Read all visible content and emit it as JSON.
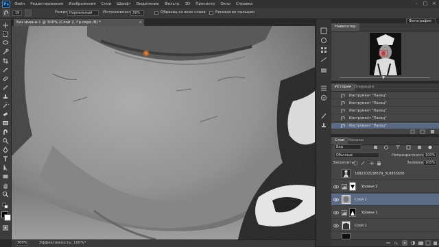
{
  "app": {
    "logo": "Ps"
  },
  "menu": [
    "Файл",
    "Редактирование",
    "Изображение",
    "Слои",
    "Шрифт",
    "Выделение",
    "Фильтр",
    "3D",
    "Просмотр",
    "Окно",
    "Справка"
  ],
  "window_controls": {
    "minimize": "–",
    "maximize": "□",
    "close": "×"
  },
  "options_bar": {
    "brush_size": "19",
    "mode_label": "Режим:",
    "mode_value": "Нормальный",
    "intensity_label": "Интенсивность:",
    "intensity_value": "39%",
    "sample_all_label": "Образец со всех слоев",
    "finger_paint_label": "Рисование пальцем",
    "workspace": "Фотография"
  },
  "document_tab": {
    "title": "Без имени-1 @ 300% (Слой 2, Гр.серо./8) *",
    "close": "×"
  },
  "status_bar": {
    "zoom": "300%",
    "efficiency": "Эффективность: 100%*"
  },
  "navigator": {
    "tab": "Навигатор"
  },
  "history": {
    "tabs": [
      "История",
      "Операции"
    ],
    "items": [
      "Инструмент \"Палец\"",
      "Инструмент \"Палец\"",
      "Инструмент \"Палец\"",
      "Инструмент \"Палец\"",
      "Инструмент \"Палец\""
    ]
  },
  "layers": {
    "tabs": [
      "Слои",
      "Каналы"
    ],
    "filter_kind": "Вид",
    "blend_mode": "Обычные",
    "opacity_label": "Непрозрачность:",
    "opacity_value": "100%",
    "lock_label": "Закрепить:",
    "fill_label": "Заливка:",
    "fill_value": "100%",
    "items": [
      {
        "name": "1682202198579_316855656"
      },
      {
        "name": "Уровни 2"
      },
      {
        "name": "Слой 2"
      },
      {
        "name": "Уровни 1"
      },
      {
        "name": "Слой 1"
      }
    ]
  },
  "colors": {
    "accent_selected": "#5b6a85",
    "ps_blue": "#4ea4f5",
    "panel_bg": "#454545"
  }
}
